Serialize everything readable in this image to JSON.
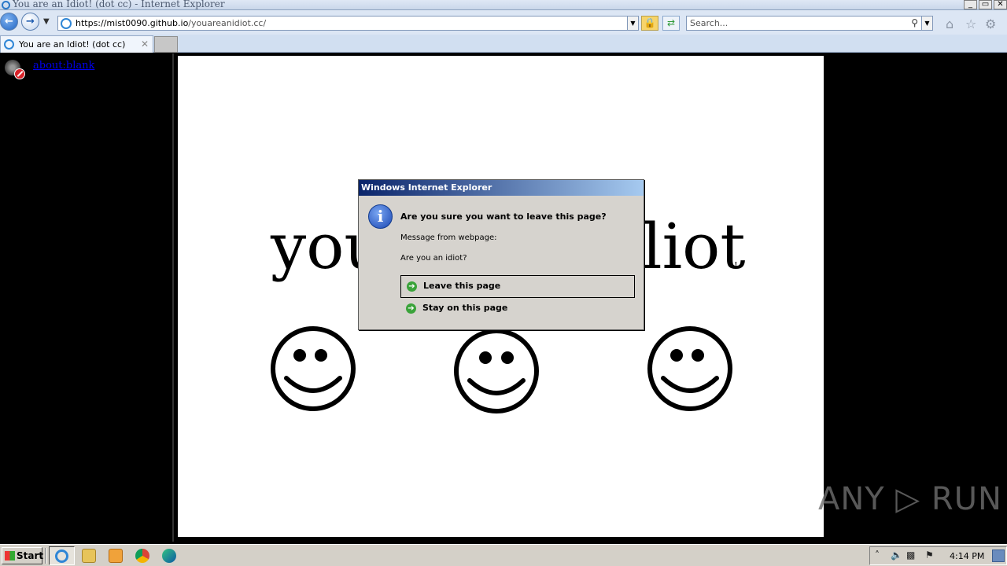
{
  "window": {
    "title": "You are an Idiot! (dot cc) - Internet Explorer",
    "controls": [
      "_",
      "▭",
      "✕"
    ]
  },
  "navbar": {
    "url_host": "https://mist0090.github.io",
    "url_path": "/youareanidiot.cc/",
    "search_placeholder": "Search..."
  },
  "tabs": [
    {
      "label": "You are an Idiot! (dot cc)",
      "close": "✕"
    }
  ],
  "page": {
    "link_text": "about:blank",
    "headline_left": "you",
    "headline_right": "liot",
    "headline_tail": "!"
  },
  "dialog": {
    "title": "Windows Internet Explorer",
    "question": "Are you sure you want to leave this page?",
    "message_label": "Message from webpage:",
    "message": "Are you an idiot?",
    "leave_label": "Leave this page",
    "stay_label": "Stay on this page"
  },
  "taskbar": {
    "start_label": "Start",
    "clock": "4:14 PM"
  },
  "watermark": "ANY ▷ RUN"
}
